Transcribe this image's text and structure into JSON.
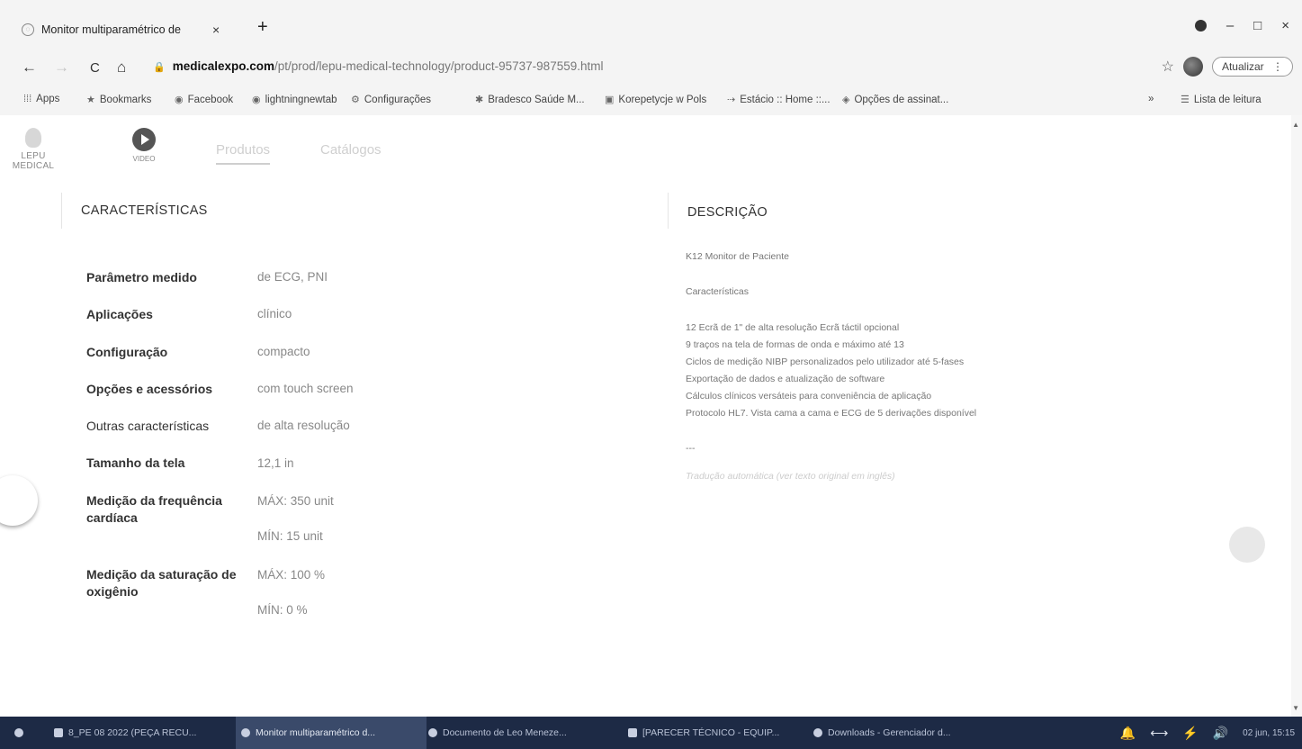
{
  "browser": {
    "tab_title": "Monitor multiparamétrico de",
    "tab_close": "×",
    "new_tab": "+",
    "url_domain": "medicalexpo.com",
    "url_path": "/pt/prod/lepu-medical-technology/product-95737-987559.html",
    "update_label": "Atualizar",
    "update_menu": "⋮",
    "win_minimize": "–",
    "win_maximize": "□",
    "win_close": "×",
    "back": "←",
    "forward": "→",
    "reload": "C",
    "home": "⌂",
    "star": "☆",
    "lock": "🔒"
  },
  "bookmarks": {
    "apps": "Apps",
    "items": [
      "Bookmarks",
      "Facebook",
      "lightningnewtab",
      "Configurações",
      "Bradesco Saúde M...",
      "Korepetycje w Pols",
      "Estácio :: Home ::...",
      "Opções de assinat..."
    ],
    "overflow": "»",
    "reading_list": "Lista de leitura"
  },
  "header": {
    "logo_text": "LEPU MEDICAL",
    "video_text": "VIDEO",
    "nav": [
      "Produtos",
      "Catálogos"
    ]
  },
  "characteristics": {
    "title": "CARACTERÍSTICAS",
    "rows": [
      {
        "label": "Parâmetro medido",
        "values": [
          "de ECG, PNI"
        ]
      },
      {
        "label": "Aplicações",
        "values": [
          "clínico"
        ]
      },
      {
        "label": "Configuração",
        "values": [
          "compacto"
        ]
      },
      {
        "label": "Opções e acessórios",
        "values": [
          "com touch screen"
        ]
      },
      {
        "label": "Outras características",
        "values": [
          "de alta resolução"
        ]
      },
      {
        "label": "Tamanho da tela",
        "values": [
          "12,1 in"
        ]
      },
      {
        "label": "Medição da frequência cardíaca",
        "values": [
          "MÁX: 350 unit",
          "MÍN: 15 unit"
        ]
      },
      {
        "label": "Medição da saturação de oxigênio",
        "values": [
          "MÁX: 100 %",
          "MÍN: 0 %"
        ]
      }
    ]
  },
  "description": {
    "title": "DESCRIÇÃO",
    "lines": [
      "K12 Monitor de Paciente",
      "Características",
      "12 Ecrã de 1\" de alta resolução Ecrã táctil opcional",
      "9 traços na tela de formas de onda e máximo até 13",
      "Ciclos de medição NIBP personalizados pelo utilizador até 5-fases",
      "Exportação de dados e atualização de software",
      "Cálculos clínicos versáteis para conveniência de aplicação",
      "Protocolo HL7. Vista cama a cama e ECG de 5 derivações disponível",
      "---",
      "Tradução automática (ver texto original em inglês)"
    ]
  },
  "taskbar": {
    "items": [
      "8_PE 08 2022 (PEÇA RECU...",
      "Monitor multiparamétrico d...",
      "Documento de Leo Meneze...",
      "[PARECER TÉCNICO - EQUIP...",
      "Downloads - Gerenciador d..."
    ],
    "clock": "02 jun, 15:15"
  }
}
